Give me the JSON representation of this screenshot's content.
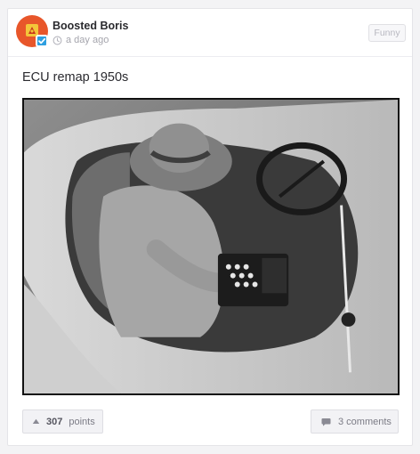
{
  "post": {
    "author": "Boosted Boris",
    "time": "a day ago",
    "category": "Funny",
    "title": "ECU remap 1950s",
    "points": "307",
    "points_label": "points",
    "comments_label": "3 comments"
  },
  "icons": {
    "verified": "checkmark-badge-icon",
    "time": "clock-icon",
    "upvote": "caret-up-icon",
    "comments": "speech-bubble-icon"
  },
  "colors": {
    "avatar_bg": "#e8562a",
    "verified_badge": "#2e9fe0"
  }
}
